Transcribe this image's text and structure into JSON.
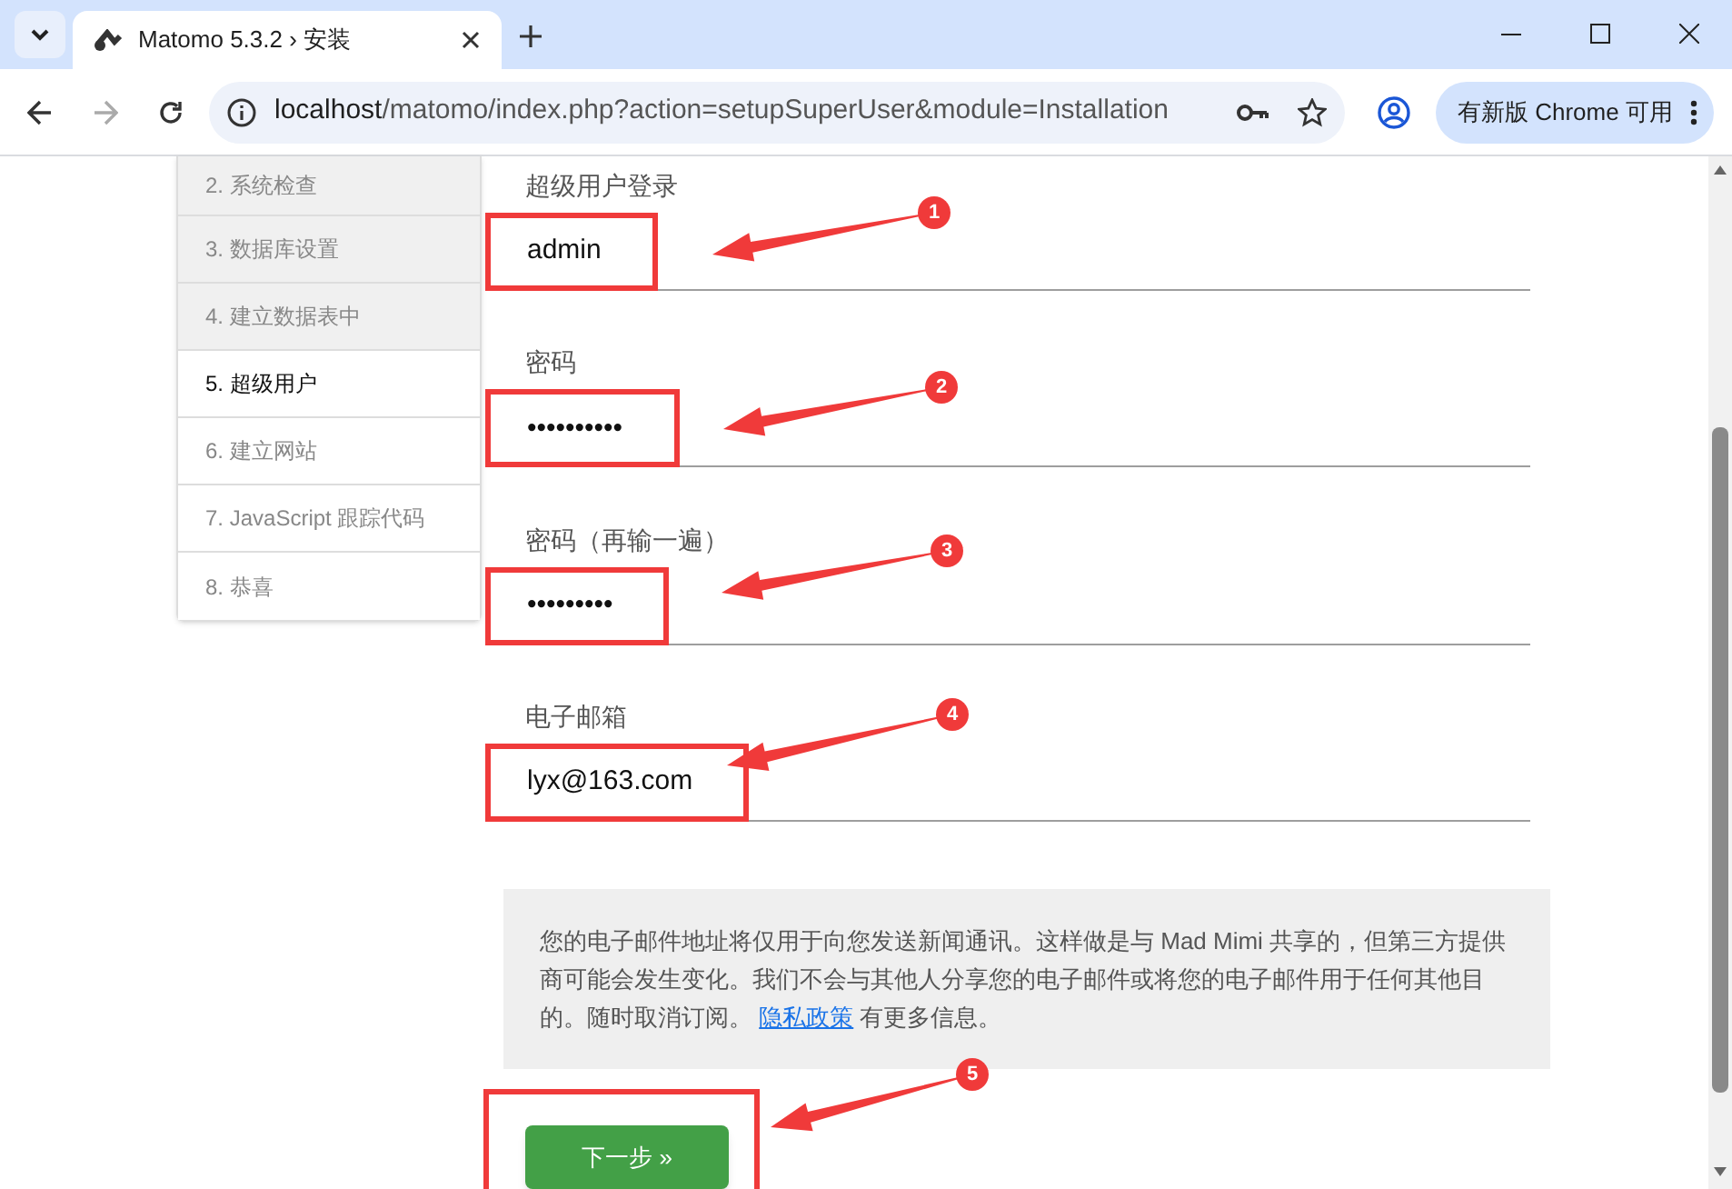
{
  "browser": {
    "tab_title": "Matomo 5.3.2 › 安装",
    "url_host": "localhost",
    "url_path": "/matomo/index.php?action=setupSuperUser&module=Installation",
    "update_button": "有新版 Chrome 可用"
  },
  "steps": [
    {
      "label": "2. 系统检查",
      "done": true,
      "selected": false
    },
    {
      "label": "3. 数据库设置",
      "done": true,
      "selected": false
    },
    {
      "label": "4. 建立数据表中",
      "done": true,
      "selected": false
    },
    {
      "label": "5. 超级用户",
      "done": false,
      "selected": true
    },
    {
      "label": "6. 建立网站",
      "done": false,
      "selected": false
    },
    {
      "label": "7. JavaScript 跟踪代码",
      "done": false,
      "selected": false
    },
    {
      "label": "8. 恭喜",
      "done": false,
      "selected": false
    }
  ],
  "fields": [
    {
      "label": "超级用户登录",
      "value": "admin"
    },
    {
      "label": "密码",
      "value": "••••••••••"
    },
    {
      "label": "密码（再输一遍）",
      "value": "•••••••••"
    },
    {
      "label": "电子邮箱",
      "value": "lyx@163.com"
    }
  ],
  "notice": "您的电子邮件地址将仅用于向您发送新闻通讯。这样做是与 Mad Mimi 共享的，但第三方提供商可能会发生变化。我们不会与其他人分享您的电子邮件或将您的电子邮件用于任何其他目的。随时取消订阅。",
  "notice_link": "隐私政策",
  "notice_tail": "有更多信息。",
  "next_button": "下一步 »",
  "annotations": [
    "1",
    "2",
    "3",
    "4",
    "5"
  ]
}
